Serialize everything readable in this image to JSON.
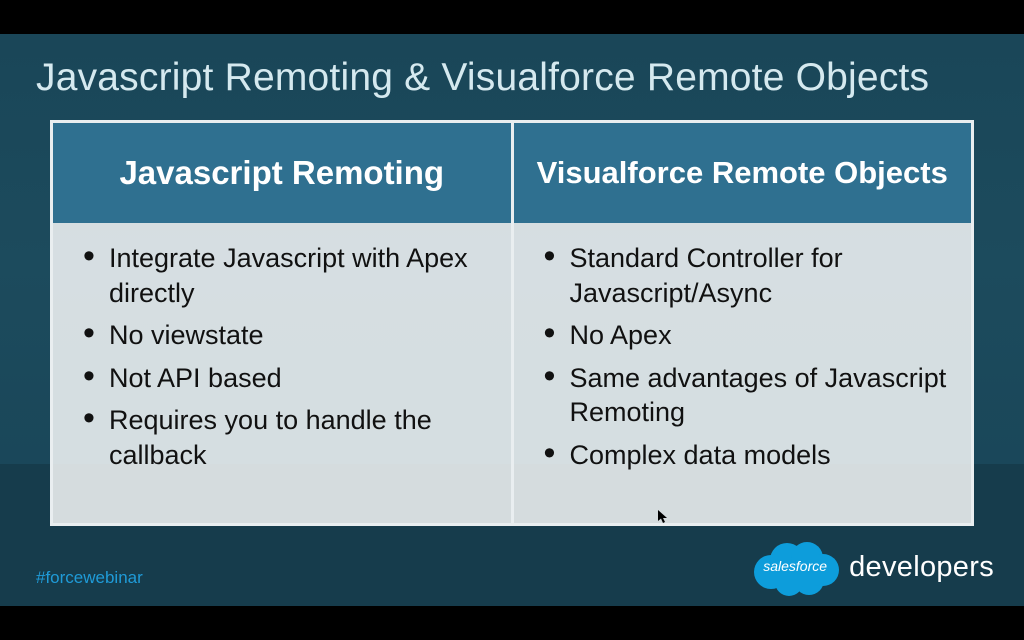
{
  "slide": {
    "title": "Javascript Remoting & Visualforce Remote Objects",
    "columns": [
      {
        "header": "Javascript Remoting",
        "items": [
          "Integrate Javascript with Apex directly",
          "No viewstate",
          "Not API based",
          "Requires you to handle the callback"
        ]
      },
      {
        "header": "Visualforce Remote Objects",
        "items": [
          "Standard Controller for Javascript/Async",
          "No Apex",
          "Same advantages of Javascript Remoting",
          "Complex data models"
        ]
      }
    ]
  },
  "footer": {
    "hashtag": "#forcewebinar",
    "brand_cloud_text": "salesforce",
    "brand_word": "developers"
  },
  "colors": {
    "slide_bg": "#1b4a5c",
    "header_bg": "#2f7090",
    "accent_blue": "#1f9bd8",
    "cloud_blue": "#0d9ddb",
    "text_light": "#d5e9ef"
  }
}
